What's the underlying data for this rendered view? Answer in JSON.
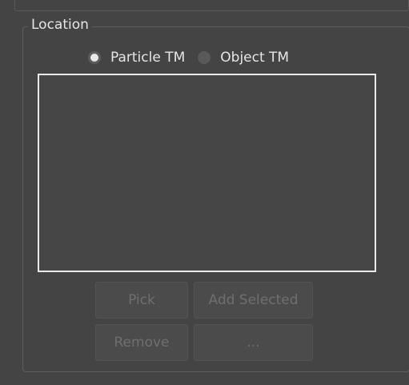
{
  "location_group": {
    "title": "Location",
    "radios": [
      {
        "label": "Particle TM",
        "checked": true
      },
      {
        "label": "Object TM",
        "checked": false
      }
    ],
    "list_items": [],
    "buttons": {
      "pick": "Pick",
      "add_selected": "Add Selected",
      "remove": "Remove",
      "more": "..."
    }
  },
  "colors": {
    "background": "#444444",
    "button_bg": "#4b4b4b",
    "disabled_text": "#6f6f6f",
    "list_border": "#e9e9e9"
  }
}
